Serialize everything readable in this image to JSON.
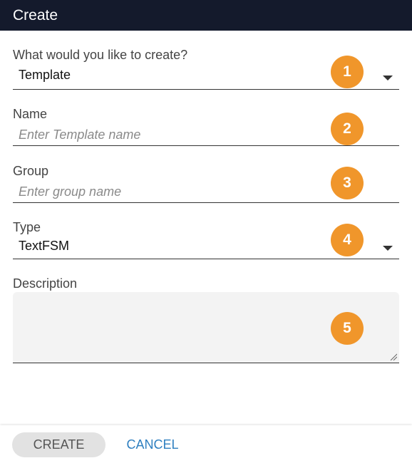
{
  "dialog": {
    "title": "Create"
  },
  "fields": {
    "create_what": {
      "label": "What would you like to create?",
      "value": "Template",
      "badge": "1"
    },
    "name": {
      "label": "Name",
      "placeholder": "Enter Template name",
      "badge": "2"
    },
    "group": {
      "label": "Group",
      "placeholder": "Enter group name",
      "badge": "3"
    },
    "type": {
      "label": "Type",
      "value": "TextFSM",
      "badge": "4"
    },
    "description": {
      "label": "Description",
      "badge": "5"
    }
  },
  "footer": {
    "create_label": "CREATE",
    "cancel_label": "CANCEL"
  },
  "colors": {
    "title_bar": "#141a2c",
    "badge": "#f0962b",
    "cancel_link": "#2e7fc0",
    "create_button_bg": "#e2e2e2"
  },
  "icons": {
    "dropdown": "chevron-down-icon",
    "resize": "resize-grip-icon"
  }
}
